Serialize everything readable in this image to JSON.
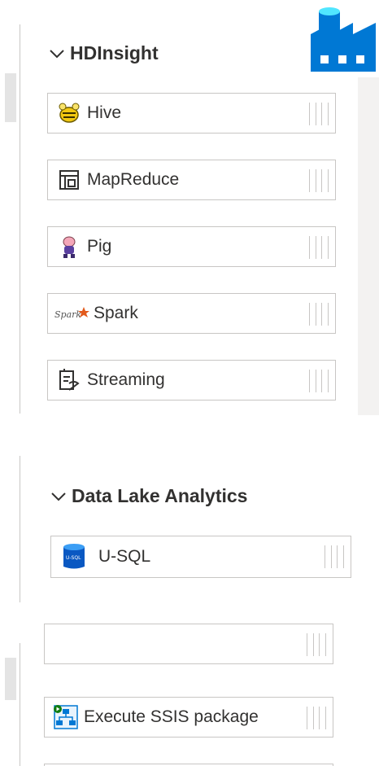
{
  "colors": {
    "azure_blue": "#0078d4",
    "border": "#c8c6c4",
    "text": "#323130"
  },
  "factory_icon": "data-factory-icon",
  "hdinsight": {
    "title": "HDInsight",
    "chevron": "chevron-down-icon",
    "items": [
      {
        "label": "Hive",
        "icon": "hive-icon"
      },
      {
        "label": "MapReduce",
        "icon": "mapreduce-icon"
      },
      {
        "label": "Pig",
        "icon": "pig-icon"
      },
      {
        "label": "Spark",
        "icon": "spark-icon"
      },
      {
        "label": "Streaming",
        "icon": "streaming-icon"
      }
    ]
  },
  "data_lake": {
    "title": "Data Lake Analytics",
    "chevron": "chevron-down-icon",
    "items": [
      {
        "label": "U-SQL",
        "icon": "usql-icon"
      }
    ]
  },
  "general": {
    "items": [
      {
        "label": "Execute SSIS package",
        "icon": "ssis-package-icon"
      }
    ]
  }
}
